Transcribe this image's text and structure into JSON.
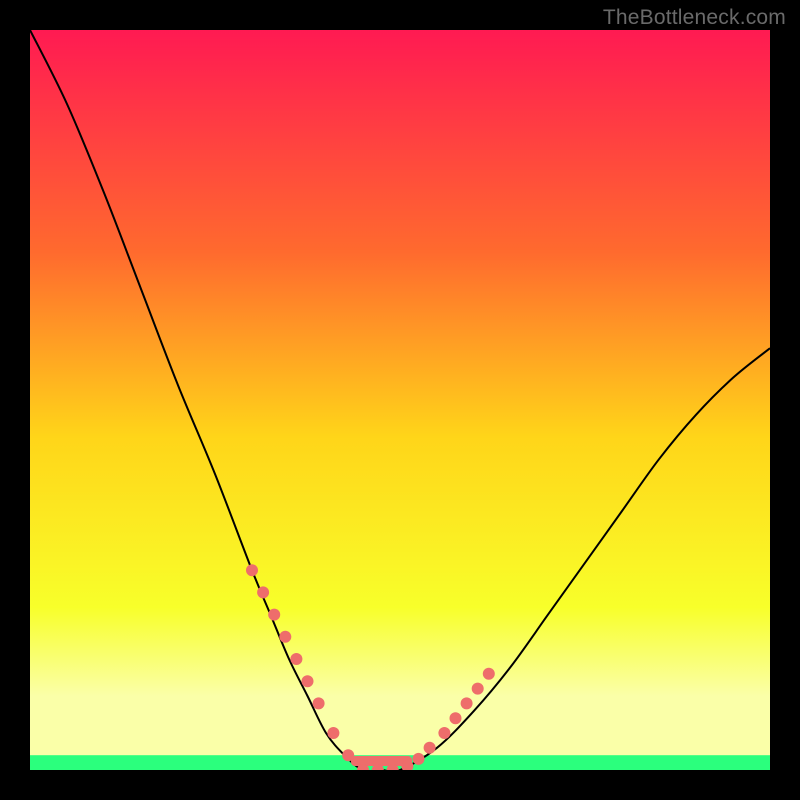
{
  "watermark": "TheBottleneck.com",
  "colors": {
    "grad_top": "#ff1a52",
    "grad_mid_upper": "#ff6a2e",
    "grad_mid": "#ffd519",
    "grad_lower": "#f8ff2a",
    "grad_pale": "#faffa8",
    "grad_bottom": "#2bff7d",
    "curve": "#000000",
    "dots": "#ee6d6b",
    "bar_fill": "#ee6d6b"
  },
  "chart_data": {
    "type": "line",
    "title": "",
    "xlabel": "",
    "ylabel": "",
    "xlim": [
      0,
      100
    ],
    "ylim": [
      0,
      100
    ],
    "grid": false,
    "legend": false,
    "series": [
      {
        "name": "bottleneck-curve",
        "x": [
          0,
          5,
          10,
          15,
          20,
          25,
          30,
          32.5,
          35,
          37.5,
          40,
          42.5,
          45,
          47.5,
          50,
          55,
          60,
          65,
          70,
          75,
          80,
          85,
          90,
          95,
          100
        ],
        "y": [
          100,
          90,
          78,
          65,
          52,
          40,
          27,
          21,
          15,
          10,
          5,
          2,
          0,
          0,
          0,
          3,
          8,
          14,
          21,
          28,
          35,
          42,
          48,
          53,
          57
        ]
      }
    ],
    "scatter_points": {
      "name": "marked-points",
      "x": [
        30,
        31.5,
        33,
        34.5,
        36,
        37.5,
        39,
        41,
        43,
        45,
        47,
        49,
        51,
        52.5,
        54,
        56,
        57.5,
        59,
        60.5,
        62
      ],
      "y": [
        27,
        24,
        21,
        18,
        15,
        12,
        9,
        5,
        2,
        0,
        0,
        0,
        0.5,
        1.5,
        3,
        5,
        7,
        9,
        11,
        13
      ]
    },
    "green_band_y": [
      0,
      2
    ],
    "annotations": []
  }
}
